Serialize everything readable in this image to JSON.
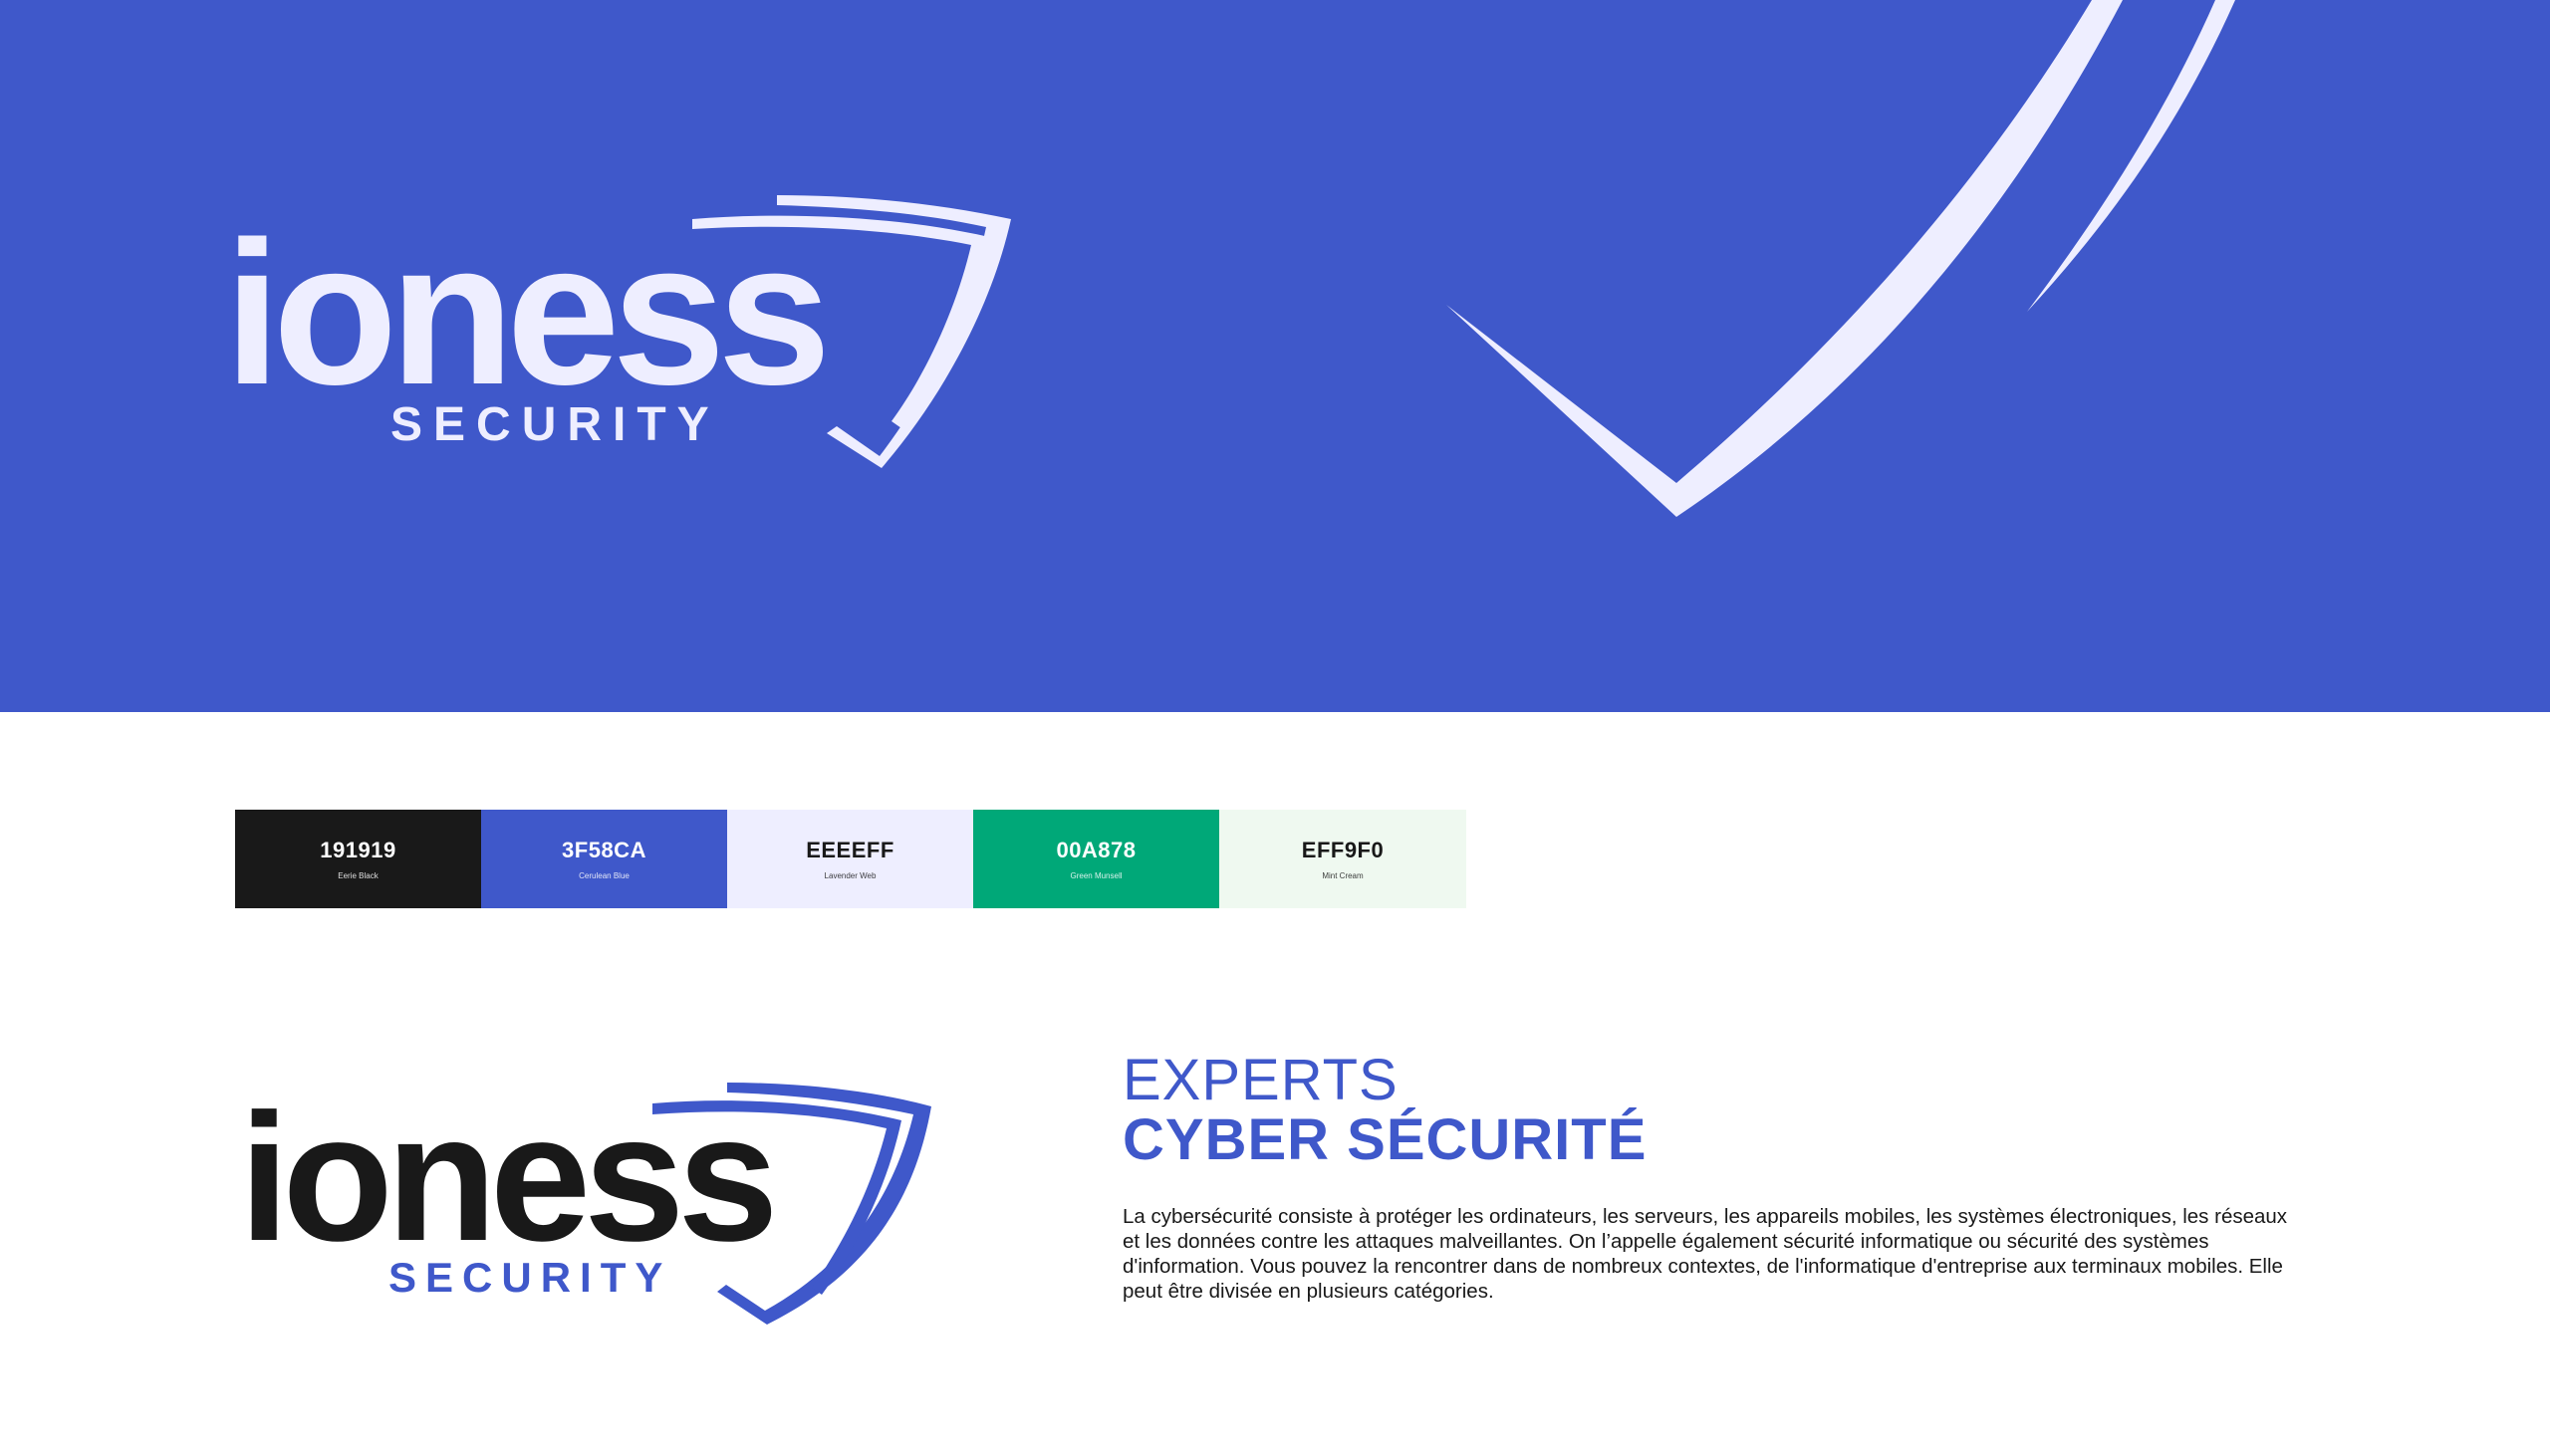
{
  "brand": {
    "wordmark": "ioness",
    "sub": "SECURITY"
  },
  "palette": [
    {
      "hex": "191919",
      "name": "Eerie Black",
      "color": "#191919",
      "text_color": "#ffffff"
    },
    {
      "hex": "3F58CA",
      "name": "Cerulean Blue",
      "color": "#3F58CA",
      "text_color": "#ffffff"
    },
    {
      "hex": "EEEEFF",
      "name": "Lavender Web",
      "color": "#EEEEFF",
      "text_color": "#191919"
    },
    {
      "hex": "00A878",
      "name": "Green Munsell",
      "color": "#00A878",
      "text_color": "#ffffff"
    },
    {
      "hex": "EFF9F0",
      "name": "Mint Cream",
      "color": "#EFF9F0",
      "text_color": "#191919"
    }
  ],
  "headline": {
    "line1": "EXPERTS",
    "line2": "CYBER SÉCURITÉ"
  },
  "body": "La cybersécurité consiste à protéger les ordinateurs, les serveurs, les appareils mobiles, les systèmes électroniques, les réseaux et les données contre les attaques malveillantes. On l’appelle également sécurité informatique ou sécurité des systèmes d'information. Vous pouvez la rencontrer dans de nombreux contextes, de l'informatique d'entreprise aux terminaux mobiles. Elle peut être divisée en plusieurs catégories.",
  "colors": {
    "primary": "#3F58CA",
    "light": "#EEEEFF",
    "dark": "#191919"
  }
}
